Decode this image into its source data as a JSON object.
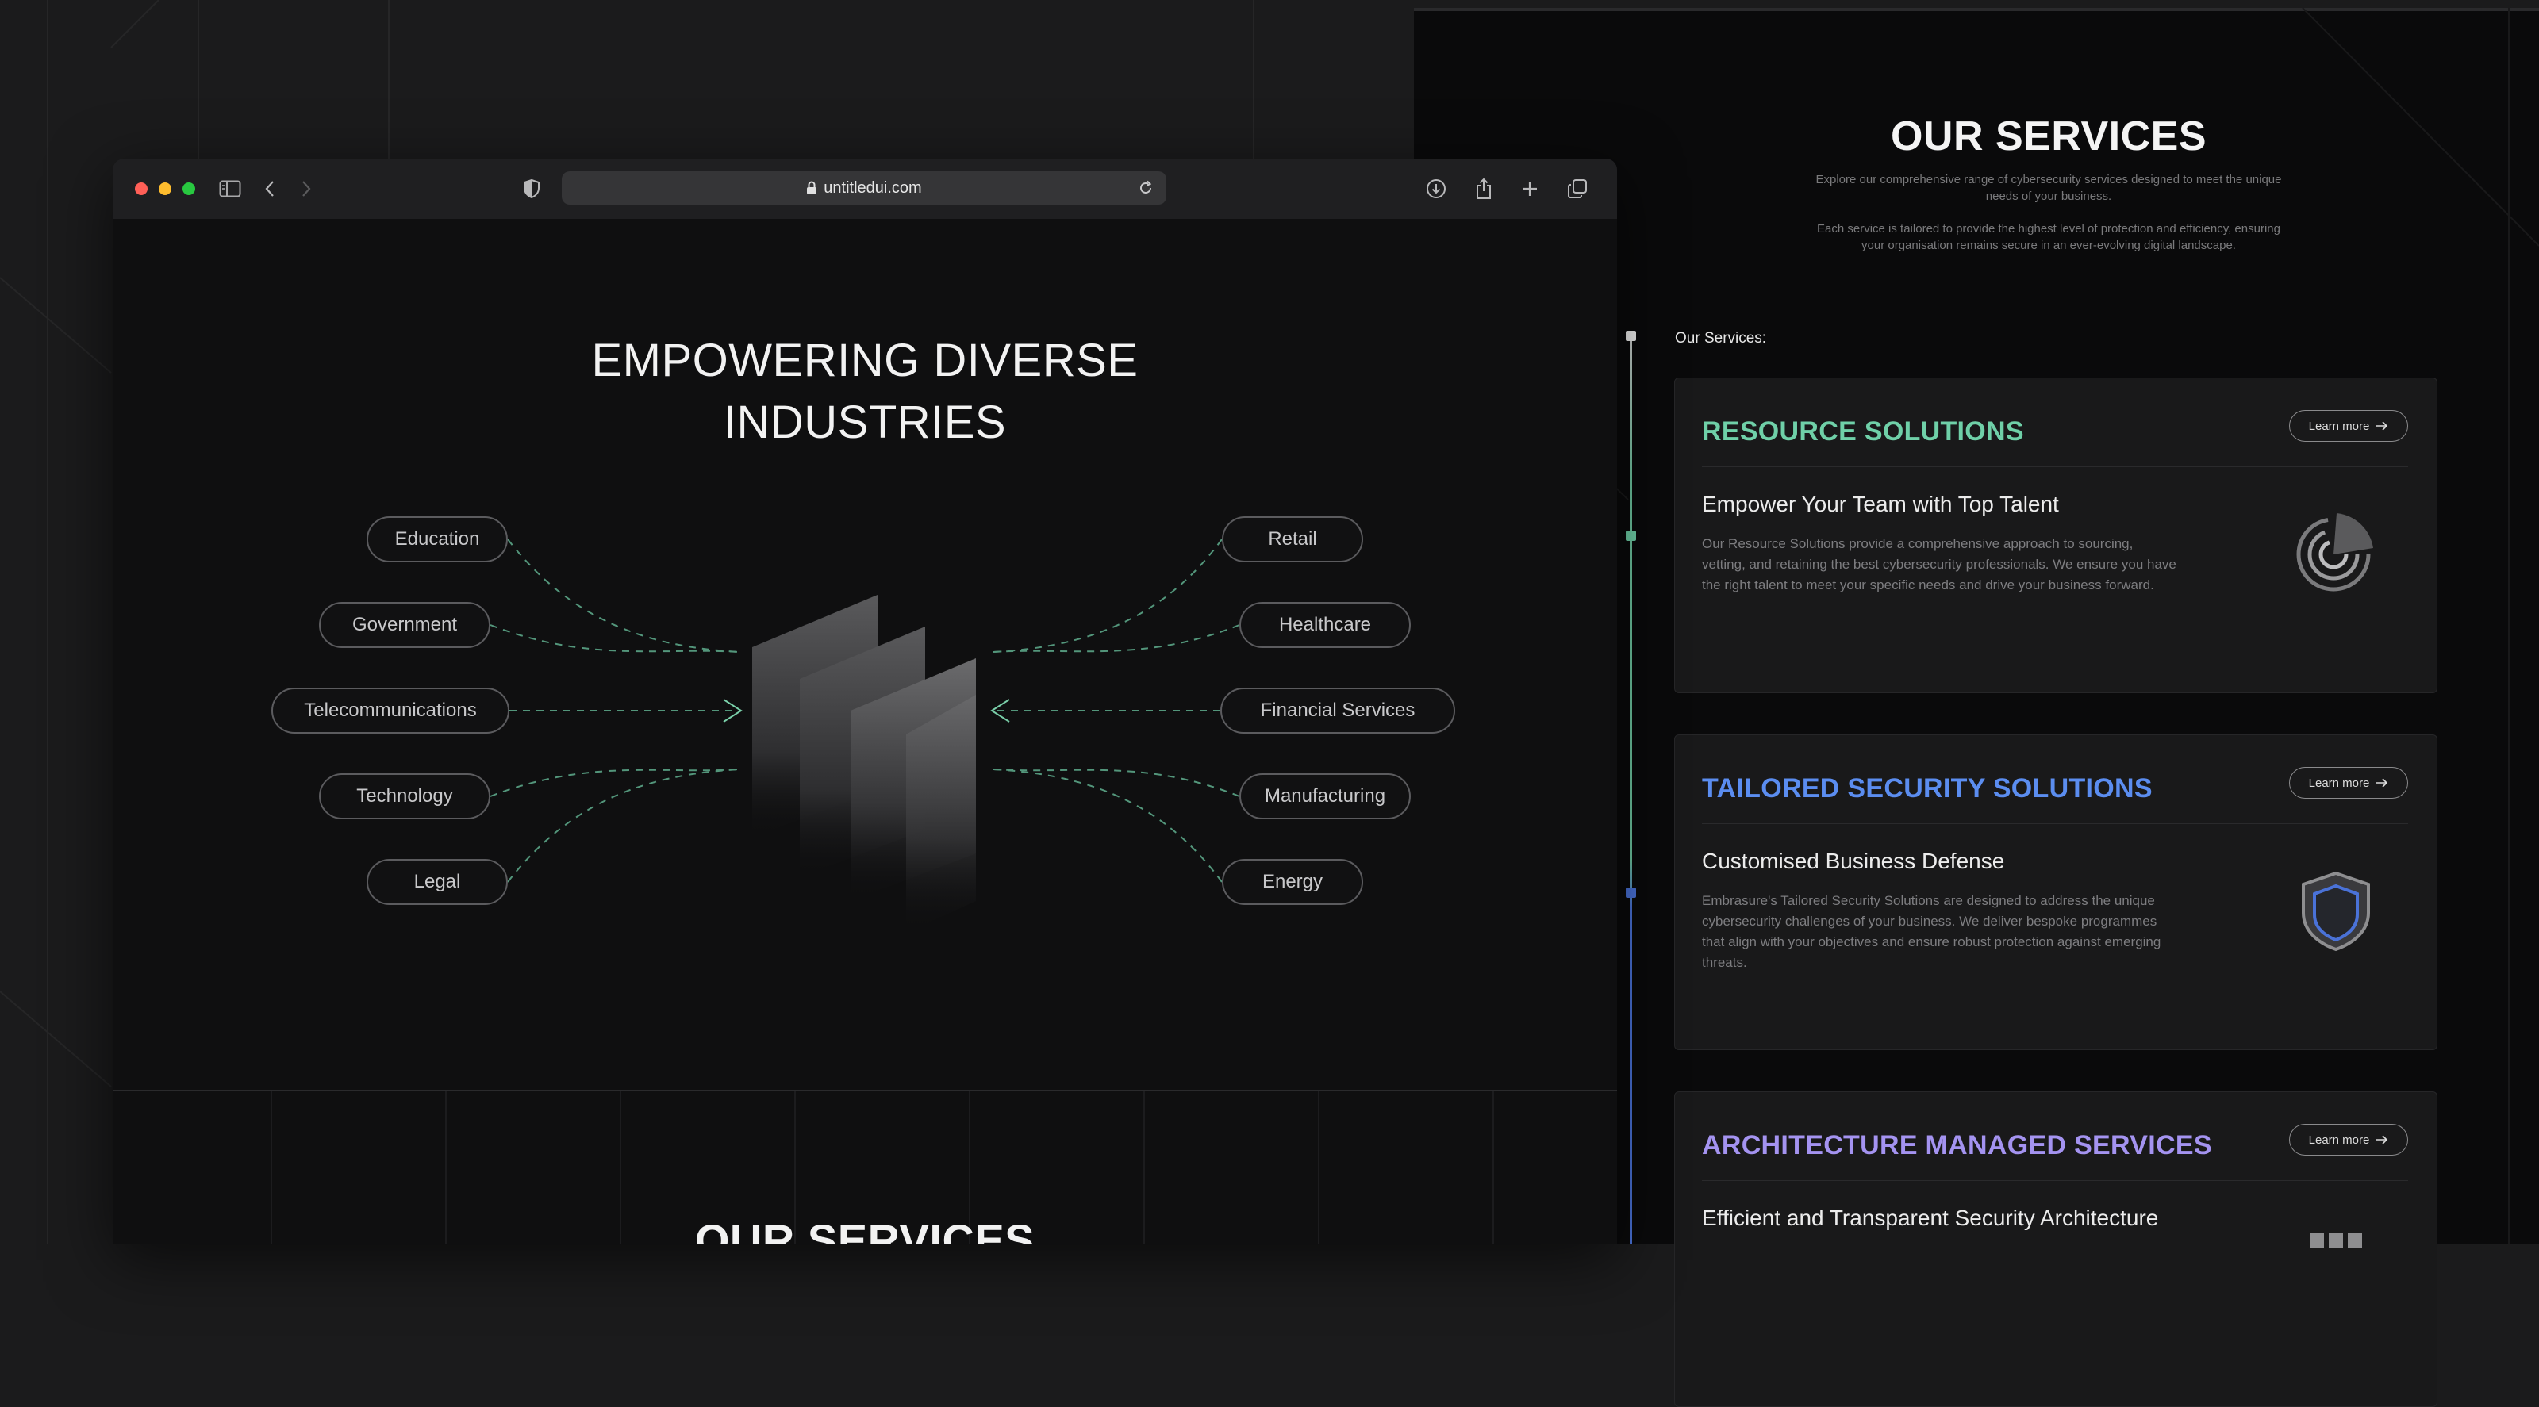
{
  "browser": {
    "url": "untitledui.com"
  },
  "industries": {
    "title_line1": "EMPOWERING DIVERSE",
    "title_line2": "INDUSTRIES",
    "left": [
      "Education",
      "Government",
      "Telecommunications",
      "Technology",
      "Legal"
    ],
    "right": [
      "Retail",
      "Healthcare",
      "Financial Services",
      "Manufacturing",
      "Energy"
    ]
  },
  "bottom_section_title": "OUR SERVICES",
  "services_page": {
    "title": "OUR SERVICES",
    "intro1": "Explore our comprehensive range of cybersecurity services designed to meet the unique needs of your business.",
    "intro2": "Each service is tailored to provide the highest level of protection and efficiency, ensuring your organisation remains secure in an ever-evolving digital landscape.",
    "list_label": "Our Services:",
    "cards": [
      {
        "title": "RESOURCE SOLUTIONS",
        "accent": "#6fd0a8",
        "subtitle": "Empower Your Team with Top Talent",
        "body": "Our Resource Solutions provide a comprehensive approach to sourcing, vetting, and retaining the best cybersecurity professionals. We ensure you have the right talent to meet your specific needs and drive your business forward.",
        "learn_label": "Learn more",
        "icon": "radar-icon"
      },
      {
        "title": "TAILORED SECURITY SOLUTIONS",
        "accent": "#5b8df0",
        "subtitle": "Customised Business Defense",
        "body": "Embrasure's Tailored Security Solutions are designed to address the unique cybersecurity challenges of your business. We deliver bespoke programmes that align with your objectives and ensure robust protection against emerging threats.",
        "learn_label": "Learn more",
        "icon": "shield-icon"
      },
      {
        "title": "ARCHITECTURE MANAGED SERVICES",
        "accent": "#a493f0",
        "subtitle": "Efficient and Transparent Security Architecture",
        "body": "",
        "learn_label": "Learn more",
        "icon": "architecture-icon"
      }
    ]
  },
  "colors": {
    "green": "#6fd0a8",
    "blue": "#5b8df0",
    "purple": "#a493f0",
    "connector": "#5fae8e"
  }
}
